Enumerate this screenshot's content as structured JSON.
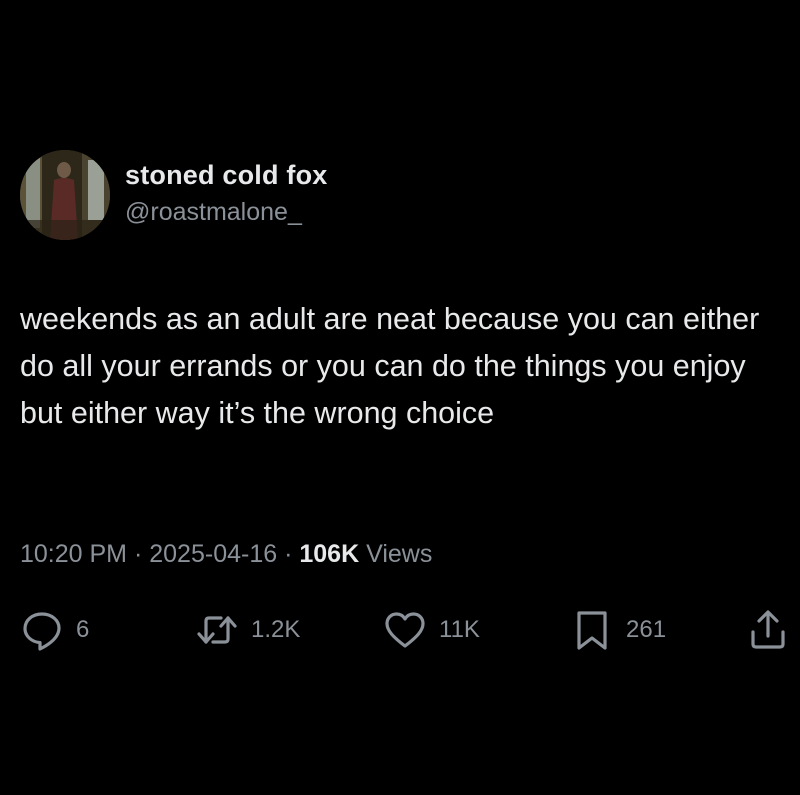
{
  "user": {
    "display_name": "stoned cold fox",
    "handle": "@roastmalone_"
  },
  "tweet": {
    "text": "weekends as an adult are neat because you can either do all your errands or you can do the things you enjoy but either way it’s the wrong choice",
    "time": "10:20 PM",
    "date": "2025-04-16",
    "views_count": "106K",
    "views_label": "Views",
    "separator": "·"
  },
  "actions": {
    "replies": "6",
    "reposts": "1.2K",
    "likes": "11K",
    "bookmarks": "261"
  },
  "icons": {
    "reply": "reply-icon",
    "repost": "repost-icon",
    "like": "heart-icon",
    "bookmark": "bookmark-icon",
    "share": "share-icon"
  },
  "colors": {
    "background": "#000000",
    "primary_text": "#e7e9ea",
    "secondary_text": "#8b9198"
  }
}
